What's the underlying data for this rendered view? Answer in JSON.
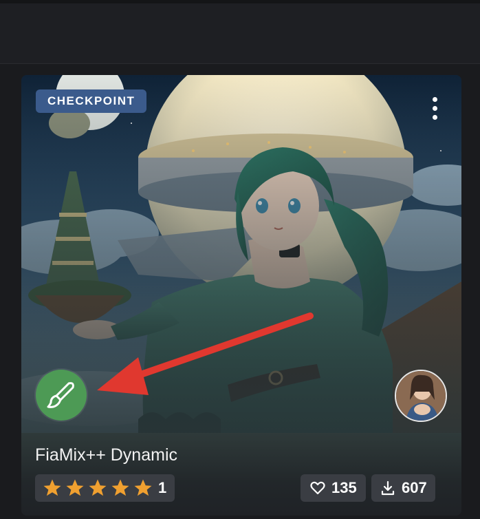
{
  "colors": {
    "badge_bg": "#3b5b8c",
    "base_model_icon_bg": "#4d9a55",
    "star": "#f0a030",
    "arrow": "#e0382f",
    "pill_bg": "#3a3d43"
  },
  "card": {
    "type_badge": "CHECKPOINT",
    "title": "FiaMix++ Dynamic",
    "menu_icon": "kebab-vertical-icon",
    "base_model_icon": "brush-icon",
    "creator_avatar": "avatar"
  },
  "stats": {
    "rating_stars": 5,
    "rating_count": "1",
    "likes": "135",
    "downloads": "607",
    "like_icon": "heart-icon",
    "download_icon": "download-icon"
  },
  "annotation": {
    "arrow_icon": "red-arrow-icon"
  }
}
